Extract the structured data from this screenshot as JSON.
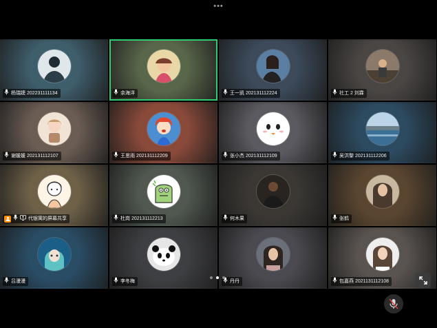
{
  "top_handle": "•••",
  "participants": [
    {
      "name": "杨瑞婕 202231111134",
      "bg": "#3f5e6c",
      "active": false,
      "avatar": "bw-person-icon",
      "host": false,
      "share": false
    },
    {
      "name": "余海洋",
      "bg": "#58664a",
      "active": true,
      "avatar": "cartoon-girl-icon",
      "host": false,
      "share": false
    },
    {
      "name": "王一凯 202131112224",
      "bg": "#3c4a5a",
      "active": false,
      "avatar": "portrait-icon",
      "host": false,
      "share": false
    },
    {
      "name": "社工 2 刘霖",
      "bg": "#4a4644",
      "active": false,
      "avatar": "street-photo-icon",
      "host": false,
      "share": false
    },
    {
      "name": "谢媛媛 202131112107",
      "bg": "#6b5d54",
      "active": false,
      "avatar": "doll-icon",
      "host": false,
      "share": false
    },
    {
      "name": "王思雨 202131112209",
      "bg": "#8a4a3a",
      "active": false,
      "avatar": "red-hair-cartoon-icon",
      "host": false,
      "share": false
    },
    {
      "name": "张小杰 202131112109",
      "bg": "#5a5a60",
      "active": false,
      "avatar": "ghost-face-icon",
      "host": false,
      "share": false
    },
    {
      "name": "吴洪黎 202131112206",
      "bg": "#2c4a60",
      "active": false,
      "avatar": "landscape-icon",
      "host": false,
      "share": false
    },
    {
      "name": "代银寓的屏幕共享",
      "bg": "#6e6148",
      "active": false,
      "avatar": "sketch-girl-icon",
      "host": true,
      "share": true
    },
    {
      "name": "杜岗 202131112213",
      "bg": "#505850",
      "active": false,
      "avatar": "green-creature-icon",
      "host": false,
      "share": false
    },
    {
      "name": "何木果",
      "bg": "#3b3834",
      "active": false,
      "avatar": "dark-person-icon",
      "host": false,
      "share": false
    },
    {
      "name": "张鹤",
      "bg": "#5a4630",
      "active": false,
      "avatar": "woman-portrait-icon",
      "host": false,
      "share": false
    },
    {
      "name": "吕漫漫",
      "bg": "#2a4d66",
      "active": false,
      "avatar": "teal-anime-icon",
      "host": false,
      "share": false
    },
    {
      "name": "李冬梅",
      "bg": "#3e3f42",
      "active": false,
      "avatar": "panda-icon",
      "host": false,
      "share": false
    },
    {
      "name": "丹丹",
      "bg": "#4a4a50",
      "active": false,
      "avatar": "girl-photo-icon",
      "host": false,
      "share": false
    },
    {
      "name": "包嘉燕 2021131112108",
      "bg": "#5a5450",
      "active": false,
      "avatar": "light-portrait-icon",
      "host": false,
      "share": false
    }
  ],
  "pager": {
    "pages": 3,
    "current": 2
  },
  "colors": {
    "active_border": "#2fcb71",
    "host_badge": "#ff8a00"
  }
}
